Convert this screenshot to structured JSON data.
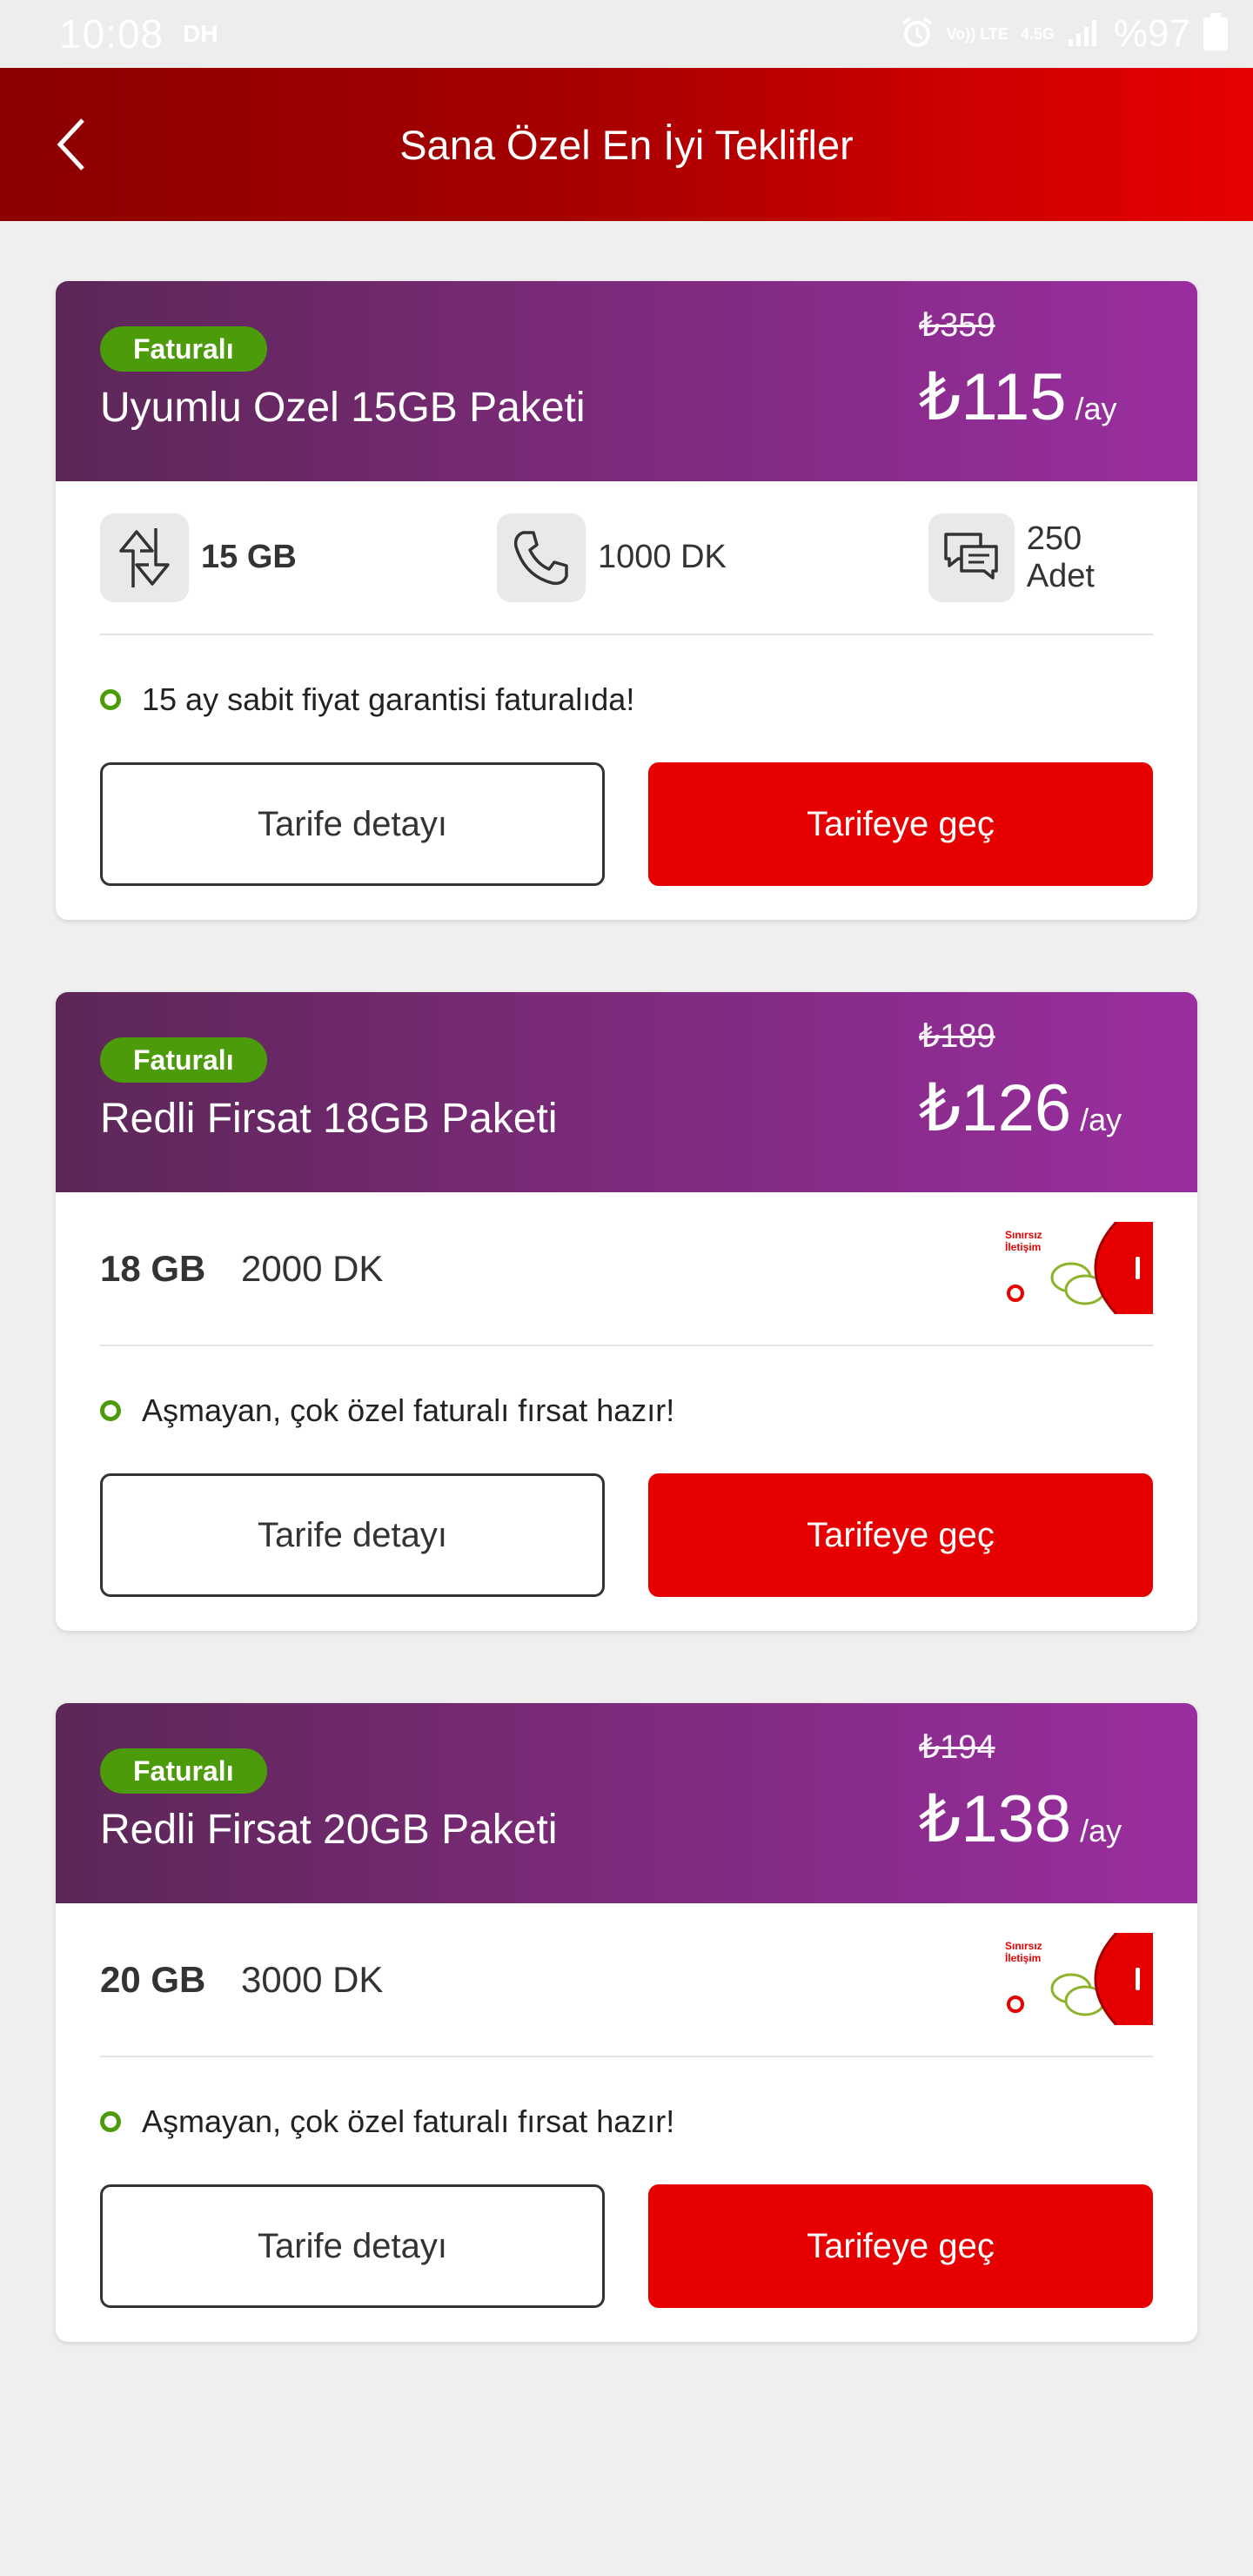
{
  "status_bar": {
    "time": "10:08",
    "carrier_tag": "DH",
    "volte": "Vo)) LTE",
    "network": "4.5G",
    "battery": "%97"
  },
  "header": {
    "title": "Sana Özel En İyi Teklifler"
  },
  "offers": [
    {
      "badge": "Faturalı",
      "name": "Uyumlu Ozel 15GB Paketi",
      "old_price": "₺359",
      "price": "₺115",
      "per": "/ay",
      "data": "15 GB",
      "minutes": "1000 DK",
      "sms": "250 Adet",
      "note": "15 ay sabit fiyat garantisi faturalıda!",
      "detail_label": "Tarife detayı",
      "switch_label": "Tarifeye geç"
    },
    {
      "badge": "Faturalı",
      "name": "Redli Firsat 18GB Paketi",
      "old_price": "₺189",
      "price": "₺126",
      "per": "/ay",
      "data": "18 GB",
      "minutes": "2000 DK",
      "promo_label": "Sınırsız İletişim",
      "note": "Aşmayan, çok özel faturalı fırsat hazır!",
      "detail_label": "Tarife detayı",
      "switch_label": "Tarifeye geç"
    },
    {
      "badge": "Faturalı",
      "name": "Redli Firsat 20GB Paketi",
      "old_price": "₺194",
      "price": "₺138",
      "per": "/ay",
      "data": "20 GB",
      "minutes": "3000 DK",
      "promo_label": "Sınırsız İletişim",
      "note": "Aşmayan, çok özel faturalı fırsat hazır!",
      "detail_label": "Tarife detayı",
      "switch_label": "Tarifeye geç"
    }
  ],
  "colors": {
    "brand_red": "#e60000",
    "card_purple": "#7a2a78",
    "badge_green": "#4b9b0a"
  }
}
